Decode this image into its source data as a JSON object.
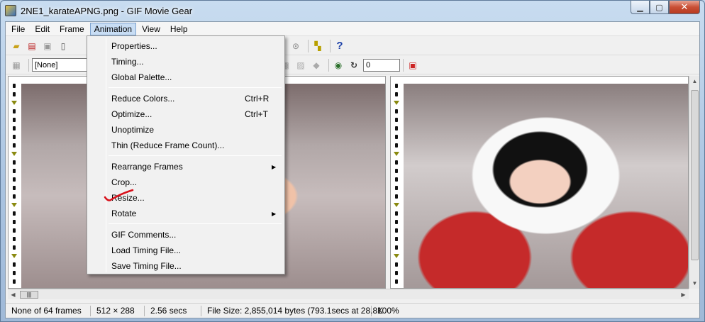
{
  "window": {
    "title": "2NE1_karateAPNG.png - GIF Movie Gear",
    "controls": {
      "minimize": "▁",
      "maximize": "▢",
      "close": "✕"
    }
  },
  "menubar": [
    {
      "label": "File"
    },
    {
      "label": "Edit"
    },
    {
      "label": "Frame"
    },
    {
      "label": "Animation"
    },
    {
      "label": "View"
    },
    {
      "label": "Help"
    }
  ],
  "toolbar2": {
    "palette_combo": "[None]",
    "loop_value": "0"
  },
  "animation_menu": {
    "groups": [
      [
        {
          "label": "Properties...",
          "shortcut": "",
          "submenu": false
        },
        {
          "label": "Timing...",
          "shortcut": "",
          "submenu": false
        },
        {
          "label": "Global Palette...",
          "shortcut": "",
          "submenu": false
        }
      ],
      [
        {
          "label": "Reduce Colors...",
          "shortcut": "Ctrl+R",
          "submenu": false
        },
        {
          "label": "Optimize...",
          "shortcut": "Ctrl+T",
          "submenu": false
        },
        {
          "label": "Unoptimize",
          "shortcut": "",
          "submenu": false
        },
        {
          "label": "Thin (Reduce Frame Count)...",
          "shortcut": "",
          "submenu": false
        }
      ],
      [
        {
          "label": "Rearrange Frames",
          "shortcut": "",
          "submenu": true
        },
        {
          "label": "Crop...",
          "shortcut": "",
          "submenu": false
        },
        {
          "label": "Resize...",
          "shortcut": "",
          "submenu": false
        },
        {
          "label": "Rotate",
          "shortcut": "",
          "submenu": true
        }
      ],
      [
        {
          "label": "GIF Comments...",
          "shortcut": "",
          "submenu": false
        },
        {
          "label": "Load Timing File...",
          "shortcut": "",
          "submenu": false
        },
        {
          "label": "Save Timing File...",
          "shortcut": "",
          "submenu": false
        }
      ]
    ]
  },
  "statusbar": {
    "frames": "None of 64 frames",
    "dimensions": "512 × 288",
    "duration": "2.56 secs",
    "filesize": "File Size: 2,855,014 bytes  (793.1secs at 28.8K",
    "zoom": "100%"
  },
  "colors": {
    "menu_highlight": "#c8ddf4",
    "annotation_mark": "#d8101a"
  }
}
